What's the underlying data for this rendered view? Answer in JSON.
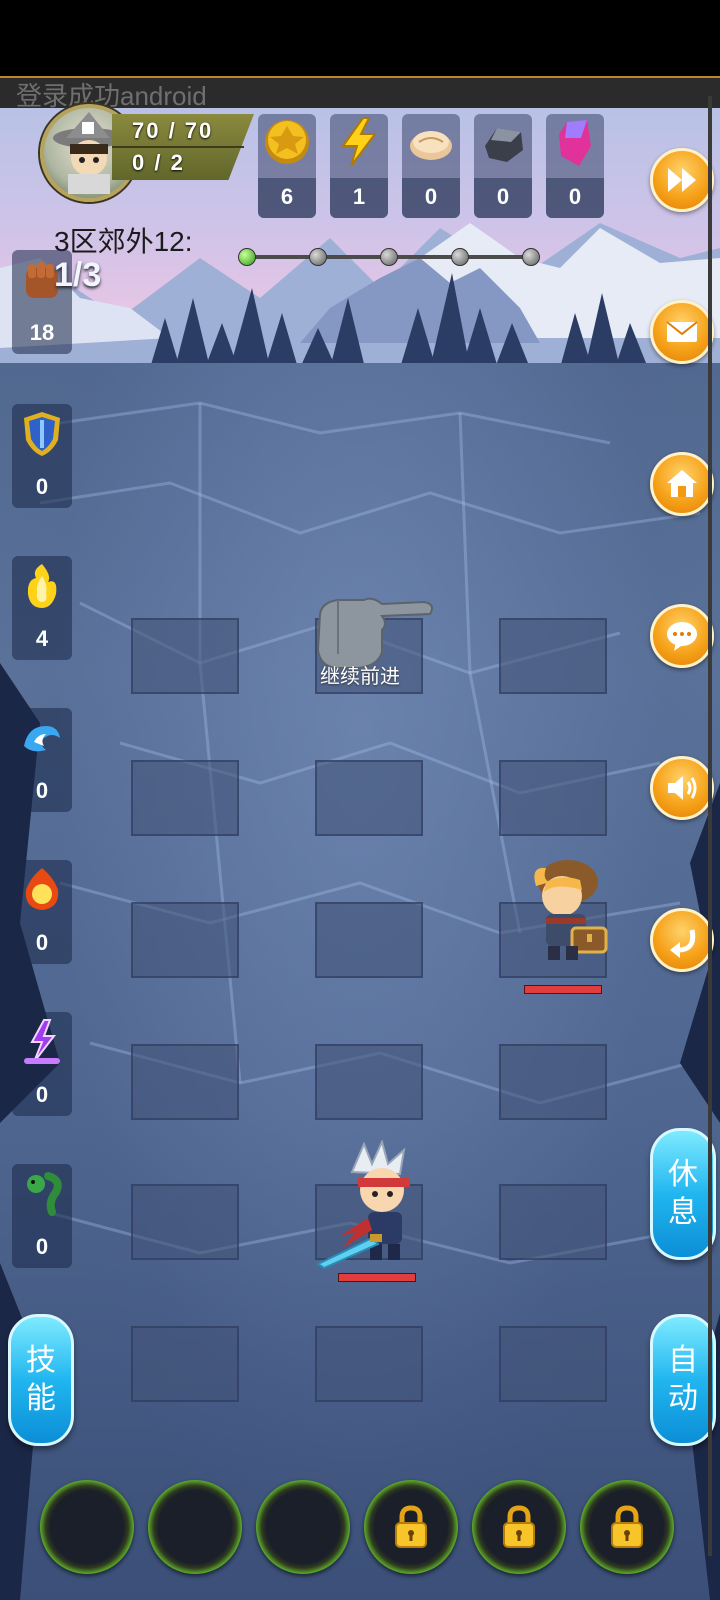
{
  "toast": "登录成功android",
  "player": {
    "hp": "70 / 70",
    "exp": "0 / 2"
  },
  "resources": [
    {
      "name": "gold-coin-icon",
      "count": "6"
    },
    {
      "name": "lightning-icon",
      "count": "1"
    },
    {
      "name": "bun-icon",
      "count": "0"
    },
    {
      "name": "ore-icon",
      "count": "0"
    },
    {
      "name": "crystal-icon",
      "count": "0"
    }
  ],
  "stage": {
    "label": "3区郊外12:",
    "wave": "1/3"
  },
  "stage_progress": {
    "total_nodes": 5,
    "current_node": 1
  },
  "side_items": [
    {
      "name": "fist-icon",
      "count": "18"
    },
    {
      "name": "shield-icon",
      "count": "0"
    },
    {
      "name": "yellow-flame-icon",
      "count": "4"
    },
    {
      "name": "wave-icon",
      "count": "0"
    },
    {
      "name": "fire-orb-icon",
      "count": "0"
    },
    {
      "name": "purple-lightning-icon",
      "count": "0"
    },
    {
      "name": "green-serpent-icon",
      "count": "0"
    }
  ],
  "right_buttons": [
    "fast-forward-icon",
    "mail-icon",
    "home-icon",
    "chat-icon",
    "sound-icon",
    "return-icon"
  ],
  "hint": "继续前进",
  "buttons": {
    "rest": [
      "休",
      "息"
    ],
    "skill": [
      "技",
      "能"
    ],
    "auto": [
      "自",
      "动"
    ]
  },
  "skill_slots": [
    {
      "locked": false
    },
    {
      "locked": false
    },
    {
      "locked": false
    },
    {
      "locked": true
    },
    {
      "locked": true
    },
    {
      "locked": true
    }
  ],
  "colors": {
    "accent_orange": "#f6a21a",
    "accent_blue": "#21b6f0",
    "hp_red": "#e23d3d",
    "progress_green": "#2f9b14"
  }
}
